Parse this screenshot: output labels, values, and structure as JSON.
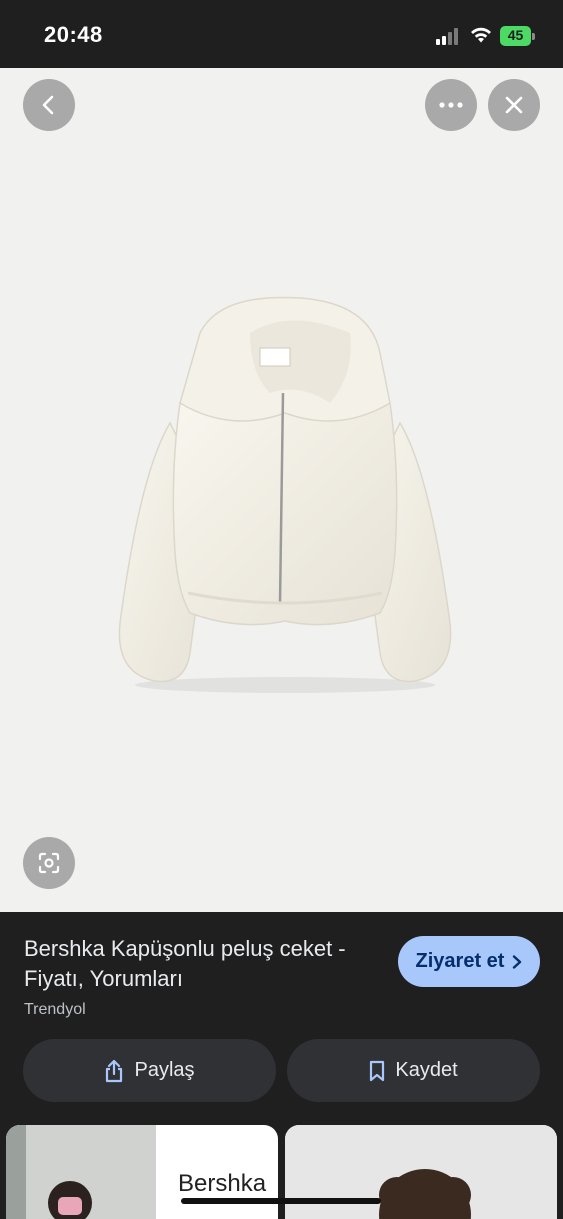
{
  "status_bar": {
    "time": "20:48",
    "battery_percent": "45",
    "icons": [
      "signal-icon",
      "wifi-icon",
      "battery-icon"
    ]
  },
  "viewer": {
    "back_icon": "chevron-left-icon",
    "more_icon": "more-horizontal-icon",
    "close_icon": "close-icon",
    "lens_icon": "lens-search-icon",
    "image_subject": "white-plush-hooded-jacket"
  },
  "result": {
    "title": "Bershka Kapüşonlu peluş ceket - Fiyatı, Yorumları",
    "source": "Trendyol",
    "visit_label": "Ziyaret et",
    "share_label": "Paylaş",
    "save_label": "Kaydet"
  },
  "related": {
    "first_brand_text": "Bershka"
  },
  "colors": {
    "background": "#1f1f1f",
    "image_background": "#f1f1f0",
    "visit_button": "#a8c7fa",
    "action_button": "#303134",
    "battery": "#4cd964"
  }
}
